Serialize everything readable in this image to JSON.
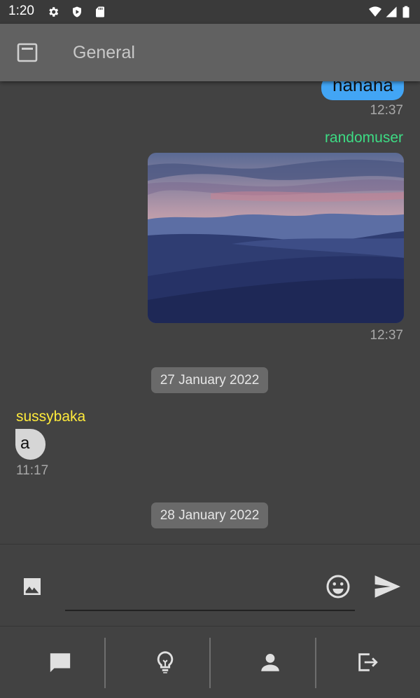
{
  "status_bar": {
    "time": "1:20",
    "icons": [
      "gear-icon",
      "shield-play-icon",
      "sd-card-icon",
      "wifi-icon",
      "signal-icon",
      "battery-icon"
    ]
  },
  "app_bar": {
    "title": "General",
    "menu_icon": "window-icon"
  },
  "messages": [
    {
      "direction": "outgoing",
      "text": "hahaha",
      "time": "12:37"
    },
    {
      "direction": "outgoing",
      "sender": "randomuser",
      "type": "image",
      "image_subject": "desert dunes at dusk",
      "time": "12:37"
    },
    {
      "type": "date_separator",
      "label": "27 January 2022"
    },
    {
      "direction": "incoming",
      "sender": "sussybaka",
      "text": "a",
      "time": "11:17"
    },
    {
      "type": "date_separator",
      "label": "28 January 2022"
    }
  ],
  "composer": {
    "input_value": "",
    "input_placeholder": "",
    "left_icon": "image-icon",
    "emoji_icon": "emoji-icon",
    "send_icon": "send-icon"
  },
  "bottom_nav": {
    "items": [
      "chat-icon",
      "lightbulb-icon",
      "person-icon",
      "logout-icon"
    ]
  },
  "colors": {
    "background": "#424242",
    "app_bar": "#616161",
    "outgoing_bubble": "#42a5f5",
    "incoming_bubble": "#d6d6d6",
    "randomuser_name": "#3ddc84",
    "sussybaka_name": "#ffeb3b",
    "time_text": "#a8a8a8"
  }
}
